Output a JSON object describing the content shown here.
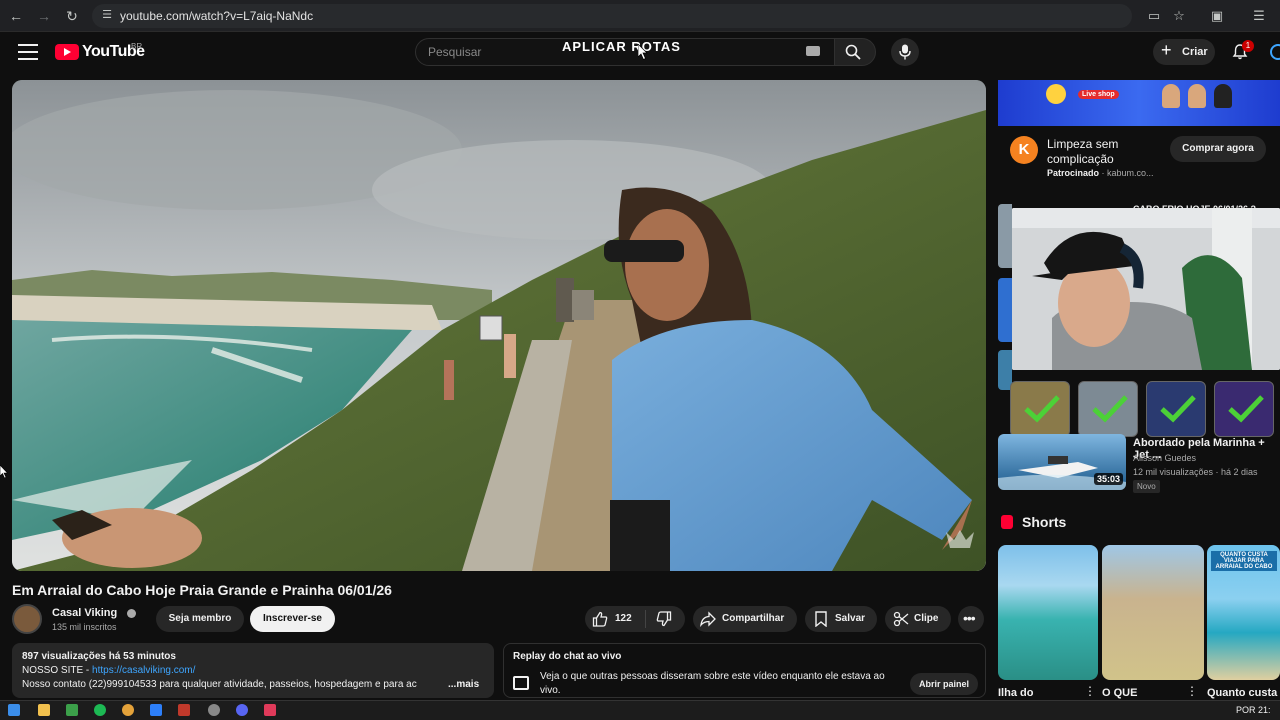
{
  "browser": {
    "url": "youtube.com/watch?v=L7aiq-NaNdc"
  },
  "header": {
    "logo_text": "YouTube",
    "country": "BR",
    "search_placeholder": "Pesquisar",
    "overlay_text": "APLICAR ROTAS",
    "create_label": "Criar",
    "notification_count": "1"
  },
  "video": {
    "title": "Em Arraial do Cabo Hoje Praia Grande e Prainha 06/01/26",
    "channel": "Casal Viking",
    "subscribers": "135 mil inscritos",
    "member_label": "Seja membro",
    "subscribe_label": "Inscrever-se",
    "likes": "122",
    "share_label": "Compartilhar",
    "save_label": "Salvar",
    "clip_label": "Clipe",
    "more_label": "•••"
  },
  "description": {
    "views": "897 visualizações  há 53 minutos",
    "site_prefix": "NOSSO SITE - ",
    "site_link": "https://casalviking.com/",
    "contact": "Nosso contato (22)999104533 para qualquer atividade, passeios, hospedagem e para ac",
    "more": "...mais"
  },
  "chat": {
    "title": "Replay do chat ao vivo",
    "text": "Veja o que outras pessoas disseram sobre este vídeo enquanto ele estava ao vivo.",
    "open_label": "Abrir painel"
  },
  "ad": {
    "shop_tag": "Live shop",
    "logo_letter": "K",
    "title": "Limpeza sem complicação",
    "sponsored": "Patrocinado",
    "domain": " · kabum.co...",
    "cta": "Comprar agora"
  },
  "recommendations": {
    "top_title": "CABO FRIO HOJE 06/01/26 ?",
    "item": {
      "title": "Abordado pela Marinha + Jet ...",
      "channel": "Alisson Guedes",
      "stats": "12 mil visualizações · há 2 dias",
      "badge": "Novo",
      "duration": "35:03"
    }
  },
  "shorts": {
    "label": "Shorts",
    "items": [
      {
        "title": "Ilha do"
      },
      {
        "title": "O QUE"
      },
      {
        "title": "Quanto custa"
      }
    ],
    "thumb_caption": "QUANTO CUSTA VIAJAR PARA ARRAIAL DO CABO"
  },
  "taskbar": {
    "lang": "POR",
    "time": "21:"
  },
  "colors": {
    "background": "#0f0f0f",
    "accent_red": "#ff0033",
    "link_blue": "#3ea6ff",
    "check_green": "#4cd137"
  }
}
